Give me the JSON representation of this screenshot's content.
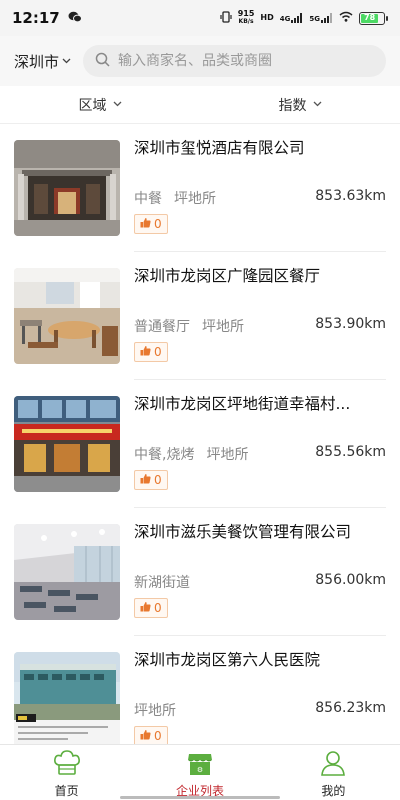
{
  "status_bar": {
    "time": "12:17",
    "speed_top": "915",
    "speed_bottom": "KB/s",
    "hd": "HD",
    "net1": "4G",
    "net2": "5G",
    "battery": "78"
  },
  "search": {
    "city": "深圳市",
    "placeholder": "输入商家名、品类或商圈"
  },
  "filters": [
    {
      "label": "区域"
    },
    {
      "label": "指数"
    }
  ],
  "listings": [
    {
      "name": "深圳市玺悦酒店有限公司",
      "tags": [
        "中餐",
        "坪地所"
      ],
      "distance": "853.63km",
      "likes": "0",
      "image": "hotel-entrance-photo"
    },
    {
      "name": "深圳市龙岗区广隆园区餐厅",
      "tags": [
        "普通餐厅",
        "坪地所"
      ],
      "distance": "853.90km",
      "likes": "0",
      "image": "canteen-tables-photo"
    },
    {
      "name": "深圳市龙岗区坪地街道幸福村...",
      "tags": [
        "中餐,烧烤",
        "坪地所"
      ],
      "distance": "855.56km",
      "likes": "0",
      "image": "restaurant-storefront-photo"
    },
    {
      "name": "深圳市滋乐美餐饮管理有限公司",
      "tags": [
        "新湖街道"
      ],
      "distance": "856.00km",
      "likes": "0",
      "image": "dining-hall-photo"
    },
    {
      "name": "深圳市龙岗区第六人民医院",
      "tags": [
        "坪地所"
      ],
      "distance": "856.23km",
      "likes": "0",
      "image": "hospital-building-photo"
    }
  ],
  "tabs": [
    {
      "label": "首页",
      "icon": "chef-hat-icon"
    },
    {
      "label": "企业列表",
      "icon": "store-icon",
      "active": true
    },
    {
      "label": "我的",
      "icon": "person-icon"
    }
  ],
  "colors": {
    "accent_green": "#5cae3f",
    "active_tab_red": "#c1272d",
    "like_orange": "#e8782f"
  }
}
